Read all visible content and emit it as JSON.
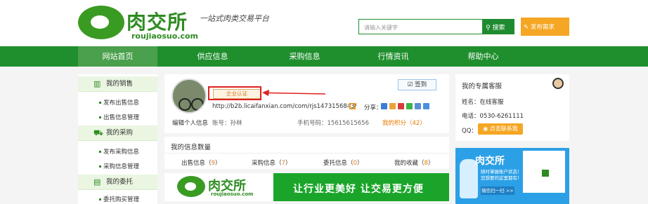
{
  "header": {
    "logo_cn": "肉交所",
    "logo_en": "roujiaosuo.com",
    "slogan": "一站式肉类交易平台",
    "search_placeholder": "请输入关键字",
    "search_button": "搜索",
    "publish_button": "发布需求"
  },
  "nav": {
    "items": [
      "网站首页",
      "供应信息",
      "采购信息",
      "行情资讯",
      "帮助中心"
    ]
  },
  "sidebar": {
    "groups": [
      {
        "label": "我的销售",
        "items": [
          "发布出售信息",
          "出售信息管理"
        ]
      },
      {
        "label": "我的采购",
        "items": [
          "发布采购信息",
          "采购信息管理"
        ]
      },
      {
        "label": "我的委托",
        "items": [
          "委托购买管理"
        ]
      }
    ]
  },
  "profile": {
    "badge": "企业认证",
    "sign_in": "签到",
    "url": "http://b2b.licaifanxian.com/com/rjs1473156843/",
    "share_label": "分享：",
    "edit_link": "编辑个人信息",
    "account": "账号：孙林",
    "phone": "手机号码：15615615656",
    "points": "我的积分（42）"
  },
  "counts": {
    "title": "我的信息数量",
    "items": [
      {
        "label": "出售信息（",
        "num": "9",
        "end": "）"
      },
      {
        "label": "采购信息（",
        "num": "7",
        "end": "）"
      },
      {
        "label": "委托信息（",
        "num": "0",
        "end": "）"
      },
      {
        "label": "我的收藏（",
        "num": "8",
        "end": "）"
      }
    ]
  },
  "banner": {
    "logo_cn": "肉交所",
    "logo_en": "roujiaosuo.com",
    "slogan": "让行业更美好  让交易更方便"
  },
  "service": {
    "title": "我的专属客服",
    "name": "姓名：在线客服",
    "phone": "电话：0530-6261111",
    "qq_label": "QQ：",
    "qq_button": "点击联系我"
  },
  "ad": {
    "title": "肉交所",
    "line1": "随时掌握账户状态！",
    "line2": "您想要的这里都有！",
    "button": "微信扫一扫 >>"
  },
  "colors": {
    "brand_green": "#1f8f2d",
    "accent_orange": "#f5a623",
    "highlight_red": "#e02020"
  }
}
